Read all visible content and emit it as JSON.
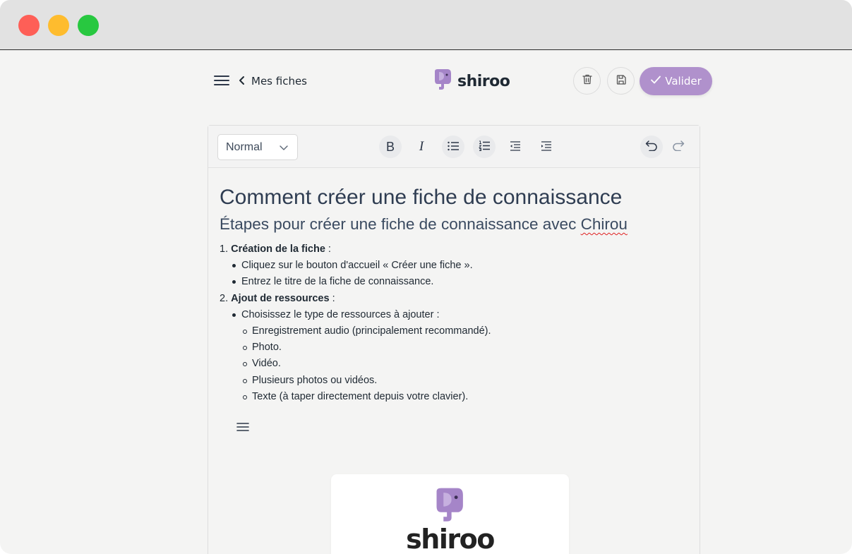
{
  "window": {
    "controls": [
      "close",
      "minimize",
      "zoom"
    ]
  },
  "header": {
    "back_label": "Mes fiches",
    "brand": "shiroo",
    "valider_label": "Valider",
    "accent_color": "#b091cc"
  },
  "toolbar": {
    "format_value": "Normal",
    "bold_label": "B",
    "italic_label": "I"
  },
  "document": {
    "title": "Comment créer une fiche de connaissance",
    "subtitle_prefix": "Étapes pour créer une fiche de connaissance avec ",
    "subtitle_word": "Chirou",
    "steps": [
      {
        "number": "1.",
        "title": "Création de la fiche",
        "suffix": " :",
        "items": [
          "Cliquez sur le bouton d'accueil « Créer une fiche ».",
          "Entrez le titre de la fiche de connaissance."
        ]
      },
      {
        "number": "2.",
        "title": "Ajout de ressources",
        "suffix": " :",
        "items": [
          "Choisissez le type de ressources à ajouter :"
        ],
        "subitems": [
          "Enregistrement audio (principalement recommandé).",
          "Photo.",
          "Vidéo.",
          "Plusieurs photos ou vidéos.",
          "Texte (à taper directement depuis votre clavier)."
        ]
      }
    ],
    "image_brand": "shiroo"
  }
}
